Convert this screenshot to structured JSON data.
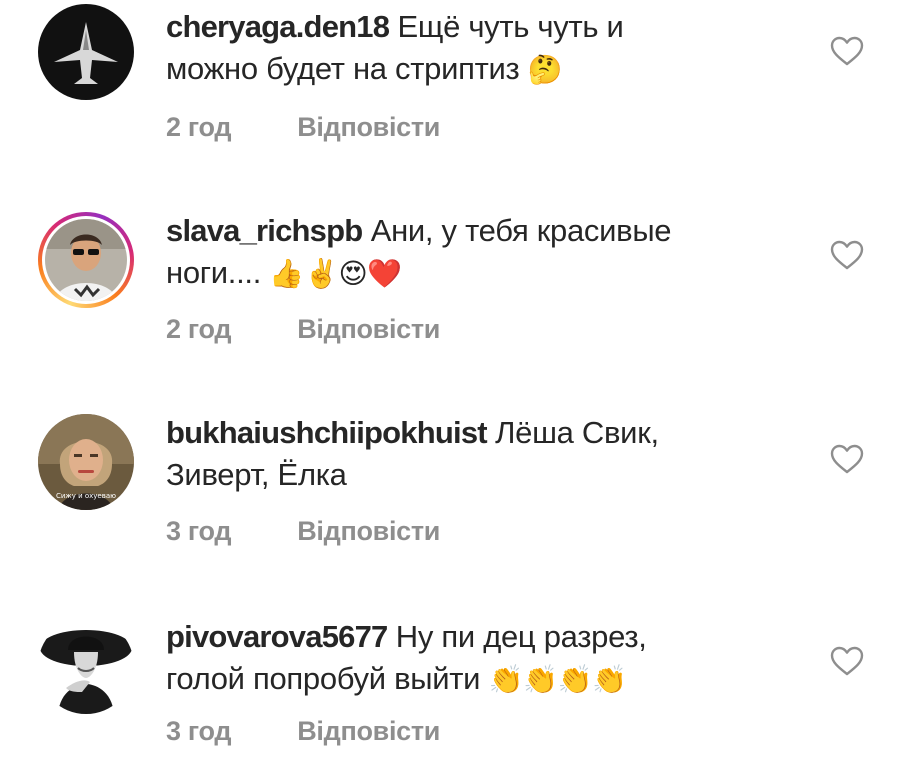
{
  "comments": [
    {
      "username": "cheryaga.den18",
      "line1": "Ещё чуть чуть и",
      "line2": "можно будет на стриптиз",
      "emoji": "🤔",
      "time": "2 год",
      "reply": "Відповісти",
      "avatar_icon": "jet-avatar"
    },
    {
      "username": "slava_richspb",
      "line1": "Ани, у тебя красивые",
      "line2": "ноги....",
      "emoji": "👍✌️😍❤️",
      "time": "2 год",
      "reply": "Відповісти",
      "avatar_icon": "man-sunglasses-avatar"
    },
    {
      "username": "bukhaiushchiipokhuist",
      "line1": "Лёша Свик,",
      "line2": "Зиверт, Ёлка",
      "emoji": "",
      "time": "3 год",
      "reply": "Відповісти",
      "avatar_icon": "woman-portrait-avatar",
      "avatar_caption": "Сижу и охуеваю"
    },
    {
      "username": "pivovarova5677",
      "line1": "Ну пи  дец разрез,",
      "line2": "голой попробуй выйти",
      "emoji": "👏👏👏👏",
      "time": "3 год",
      "reply": "Відповісти",
      "avatar_icon": "woman-hat-avatar"
    }
  ],
  "colors": {
    "text": "#262626",
    "meta": "#8e8e8e",
    "heart_outline": "#8e8e8e"
  }
}
